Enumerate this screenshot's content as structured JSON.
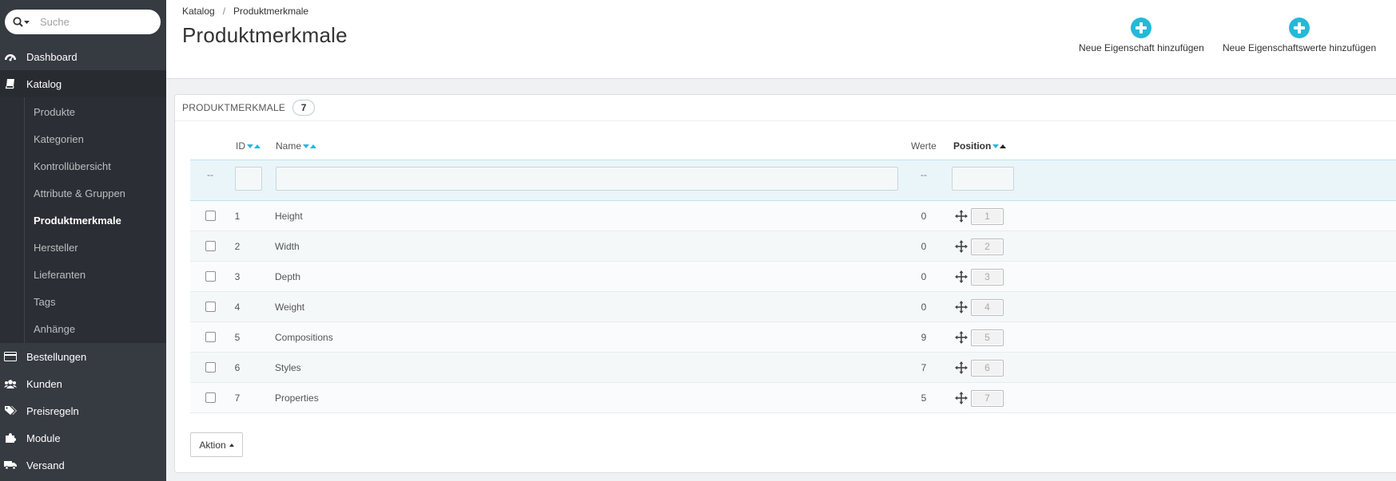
{
  "search": {
    "placeholder": "Suche"
  },
  "sidebar": {
    "items": [
      {
        "label": "Dashboard",
        "icon": "dashboard-icon"
      },
      {
        "label": "Katalog",
        "icon": "book-icon",
        "active": true,
        "subitems": [
          {
            "label": "Produkte"
          },
          {
            "label": "Kategorien"
          },
          {
            "label": "Kontrollübersicht"
          },
          {
            "label": "Attribute & Gruppen"
          },
          {
            "label": "Produktmerkmale",
            "current": true
          },
          {
            "label": "Hersteller"
          },
          {
            "label": "Lieferanten"
          },
          {
            "label": "Tags"
          },
          {
            "label": "Anhänge"
          }
        ]
      },
      {
        "label": "Bestellungen",
        "icon": "credit-card-icon"
      },
      {
        "label": "Kunden",
        "icon": "users-icon"
      },
      {
        "label": "Preisregeln",
        "icon": "tags-icon"
      },
      {
        "label": "Module",
        "icon": "puzzle-icon"
      },
      {
        "label": "Versand",
        "icon": "truck-icon"
      }
    ]
  },
  "breadcrumb": {
    "parent": "Katalog",
    "separator": "/",
    "current": "Produktmerkmale"
  },
  "page_title": "Produktmerkmale",
  "toolbar": {
    "add_feature": "Neue Eigenschaft hinzufügen",
    "add_feature_value": "Neue Eigenschaftswerte hinzufügen",
    "accent_color": "#25b9d7"
  },
  "panel": {
    "title": "PRODUKTMERKMALE",
    "count": "7"
  },
  "table": {
    "columns": {
      "id": "ID",
      "name": "Name",
      "values": "Werte",
      "position": "Position"
    },
    "filter": {
      "dash_select": "--",
      "dash_values": "--"
    },
    "rows": [
      {
        "id": "1",
        "name": "Height",
        "values": "0",
        "position": "1"
      },
      {
        "id": "2",
        "name": "Width",
        "values": "0",
        "position": "2"
      },
      {
        "id": "3",
        "name": "Depth",
        "values": "0",
        "position": "3"
      },
      {
        "id": "4",
        "name": "Weight",
        "values": "0",
        "position": "4"
      },
      {
        "id": "5",
        "name": "Compositions",
        "values": "9",
        "position": "5"
      },
      {
        "id": "6",
        "name": "Styles",
        "values": "7",
        "position": "6"
      },
      {
        "id": "7",
        "name": "Properties",
        "values": "5",
        "position": "7"
      }
    ]
  },
  "bulk_action": {
    "label": "Aktion"
  }
}
